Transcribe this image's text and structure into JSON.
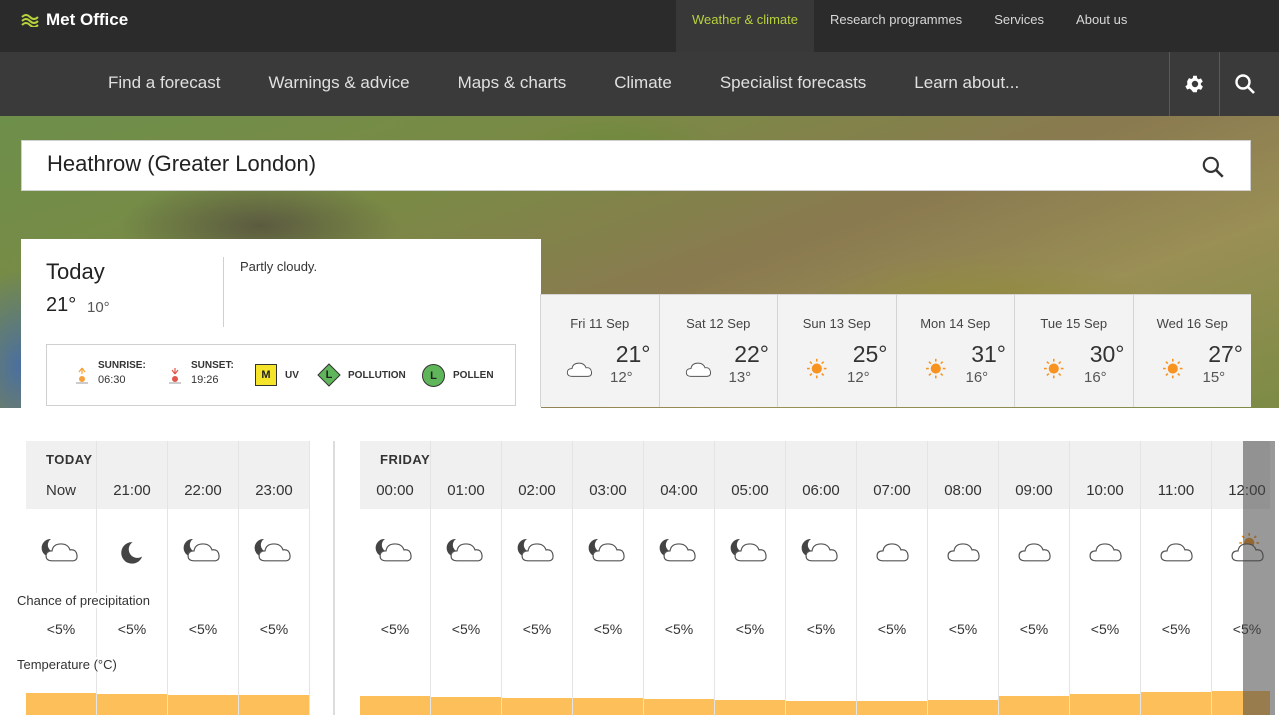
{
  "brand": {
    "name": "Met Office"
  },
  "top_nav": [
    "Weather & climate",
    "Research programmes",
    "Services",
    "About us"
  ],
  "main_nav": [
    "Find a forecast",
    "Warnings & advice",
    "Maps & charts",
    "Climate",
    "Specialist forecasts",
    "Learn about..."
  ],
  "search": {
    "value": "Heathrow (Greater London)"
  },
  "today": {
    "title": "Today",
    "high": "21°",
    "low": "10°",
    "description": "Partly cloudy.",
    "sunrise_label": "SUNRISE:",
    "sunrise": "06:30",
    "sunset_label": "SUNSET:",
    "sunset": "19:26",
    "uv_level": "M",
    "uv_label": "UV",
    "pollution_level": "L",
    "pollution_label": "POLLUTION",
    "pollen_level": "L",
    "pollen_label": "POLLEN"
  },
  "days": [
    {
      "date": "Fri 11 Sep",
      "high": "21°",
      "low": "12°",
      "icon": "cloud"
    },
    {
      "date": "Sat 12 Sep",
      "high": "22°",
      "low": "13°",
      "icon": "cloud"
    },
    {
      "date": "Sun 13 Sep",
      "high": "25°",
      "low": "12°",
      "icon": "sun"
    },
    {
      "date": "Mon 14 Sep",
      "high": "31°",
      "low": "16°",
      "icon": "sun"
    },
    {
      "date": "Tue 15 Sep",
      "high": "30°",
      "low": "16°",
      "icon": "sun"
    },
    {
      "date": "Wed 16 Sep",
      "high": "27°",
      "low": "15°",
      "icon": "sun"
    }
  ],
  "hourly": {
    "today_label": "TODAY",
    "friday_label": "FRIDAY",
    "precip_label": "Chance of precipitation",
    "temp_label": "Temperature (°C)",
    "today": [
      {
        "time": "Now",
        "icon": "moon-cloud",
        "precip": "<5%"
      },
      {
        "time": "21:00",
        "icon": "moon",
        "precip": "<5%"
      },
      {
        "time": "22:00",
        "icon": "moon-cloud",
        "precip": "<5%"
      },
      {
        "time": "23:00",
        "icon": "moon-cloud",
        "precip": "<5%"
      }
    ],
    "friday": [
      {
        "time": "00:00",
        "icon": "moon-cloud",
        "precip": "<5%"
      },
      {
        "time": "01:00",
        "icon": "moon-cloud",
        "precip": "<5%"
      },
      {
        "time": "02:00",
        "icon": "moon-cloud",
        "precip": "<5%"
      },
      {
        "time": "03:00",
        "icon": "moon-cloud",
        "precip": "<5%"
      },
      {
        "time": "04:00",
        "icon": "moon-cloud",
        "precip": "<5%"
      },
      {
        "time": "05:00",
        "icon": "moon-cloud",
        "precip": "<5%"
      },
      {
        "time": "06:00",
        "icon": "moon-cloud",
        "precip": "<5%"
      },
      {
        "time": "07:00",
        "icon": "cloud",
        "precip": "<5%"
      },
      {
        "time": "08:00",
        "icon": "cloud",
        "precip": "<5%"
      },
      {
        "time": "09:00",
        "icon": "cloud",
        "precip": "<5%"
      },
      {
        "time": "10:00",
        "icon": "cloud",
        "precip": "<5%"
      },
      {
        "time": "11:00",
        "icon": "cloud",
        "precip": "<5%"
      },
      {
        "time": "12:00",
        "icon": "sun-cloud",
        "precip": "<5%"
      }
    ]
  },
  "colors": {
    "accent": "#b6d23c",
    "uv_moderate": "#f5e42a",
    "air_low": "#5fb65a",
    "temp_bar": "#fcbf5a"
  }
}
